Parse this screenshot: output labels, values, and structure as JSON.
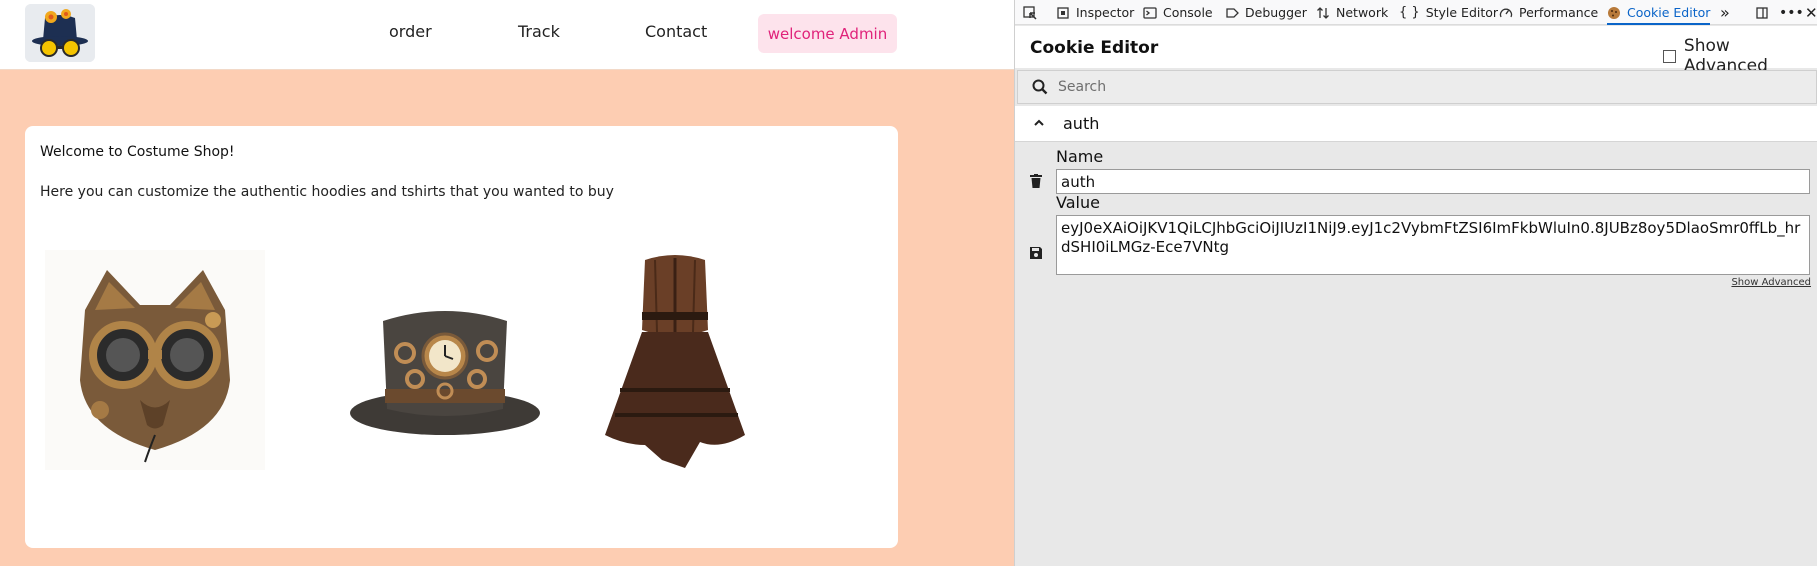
{
  "site": {
    "nav": {
      "order": "order",
      "track": "Track",
      "contact": "Contact",
      "welcome": "welcome Admin"
    },
    "card": {
      "title": "Welcome to Costume Shop!",
      "description": "Here you can customize the authentic hoodies and tshirts that you wanted to buy"
    },
    "products": [
      "steampunk-cat-mask",
      "steampunk-top-hat",
      "steampunk-corset-dress"
    ],
    "colors": {
      "background": "#fdcdb2",
      "accent": "#e0227a",
      "welcome_bg": "#fde3ec"
    }
  },
  "devtools": {
    "tabs": [
      "Inspector",
      "Console",
      "Debugger",
      "Network",
      "Style Editor",
      "Performance",
      "Cookie Editor"
    ],
    "active_tab": "Cookie Editor",
    "accent": "#0a64c8"
  },
  "cookie_editor": {
    "title": "Cookie Editor",
    "show_advanced_label": "Show Advanced",
    "show_advanced_checked": false,
    "search_placeholder": "Search",
    "cookie": {
      "name": "auth",
      "name_label": "Name",
      "value_label": "Value",
      "value": "eyJ0eXAiOiJKV1QiLCJhbGciOiJIUzI1NiJ9.eyJ1c2VybmFtZSI6ImFkbWluIn0.8JUBz8oy5DlaoSmr0ffLb_hrdSHI0iLMGz-Ece7VNtg"
    },
    "show_advanced_link": "Show Advanced"
  }
}
